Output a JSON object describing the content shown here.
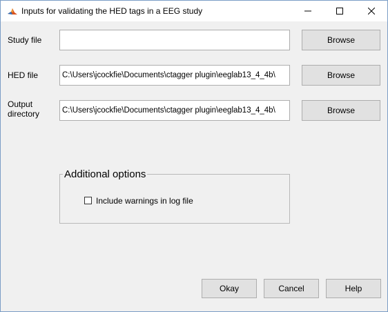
{
  "window": {
    "title": "Inputs for validating the HED tags in a EEG study",
    "icon": "matlab-icon",
    "controls": [
      "minimize-icon",
      "maximize-icon",
      "close-icon"
    ]
  },
  "form": {
    "study_file": {
      "label": "Study file",
      "value": "",
      "browse_label": "Browse"
    },
    "hed_file": {
      "label": "HED file",
      "value": "C:\\Users\\jcockfie\\Documents\\ctagger plugin\\eeglab13_4_4b\\",
      "browse_label": "Browse"
    },
    "output_directory": {
      "label_line1": "Output",
      "label_line2": "directory",
      "value": "C:\\Users\\jcockfie\\Documents\\ctagger plugin\\eeglab13_4_4b\\",
      "browse_label": "Browse"
    }
  },
  "options": {
    "title": "Additional options",
    "include_warnings": {
      "label": "Include warnings in log file",
      "checked": false
    }
  },
  "buttons": {
    "okay": "Okay",
    "cancel": "Cancel",
    "help": "Help"
  }
}
